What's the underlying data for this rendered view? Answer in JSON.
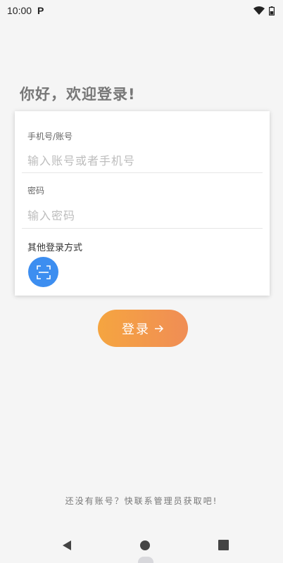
{
  "status_bar": {
    "time": "10:00",
    "app_icon": "P",
    "icons": [
      "wifi-icon",
      "battery-icon"
    ]
  },
  "greeting": "你好，欢迎登录!",
  "form": {
    "account_label": "手机号/账号",
    "account_placeholder": "输入账号或者手机号",
    "account_value": "",
    "password_label": "密码",
    "password_placeholder": "输入密码",
    "password_value": "",
    "other_methods_label": "其他登录方式",
    "other_methods_icon": "scan-icon"
  },
  "login_button": {
    "label": "登录",
    "icon": "arrow-right-icon",
    "gradient": [
      "#f5a540",
      "#f08d55"
    ]
  },
  "footer": "还没有账号？快联系管理员获取吧!",
  "nav_bar": {
    "icons": [
      "back-icon",
      "home-icon",
      "recent-apps-icon"
    ]
  },
  "colors": {
    "accent_blue": "#3d8ef0",
    "background": "#f5f5f5"
  }
}
